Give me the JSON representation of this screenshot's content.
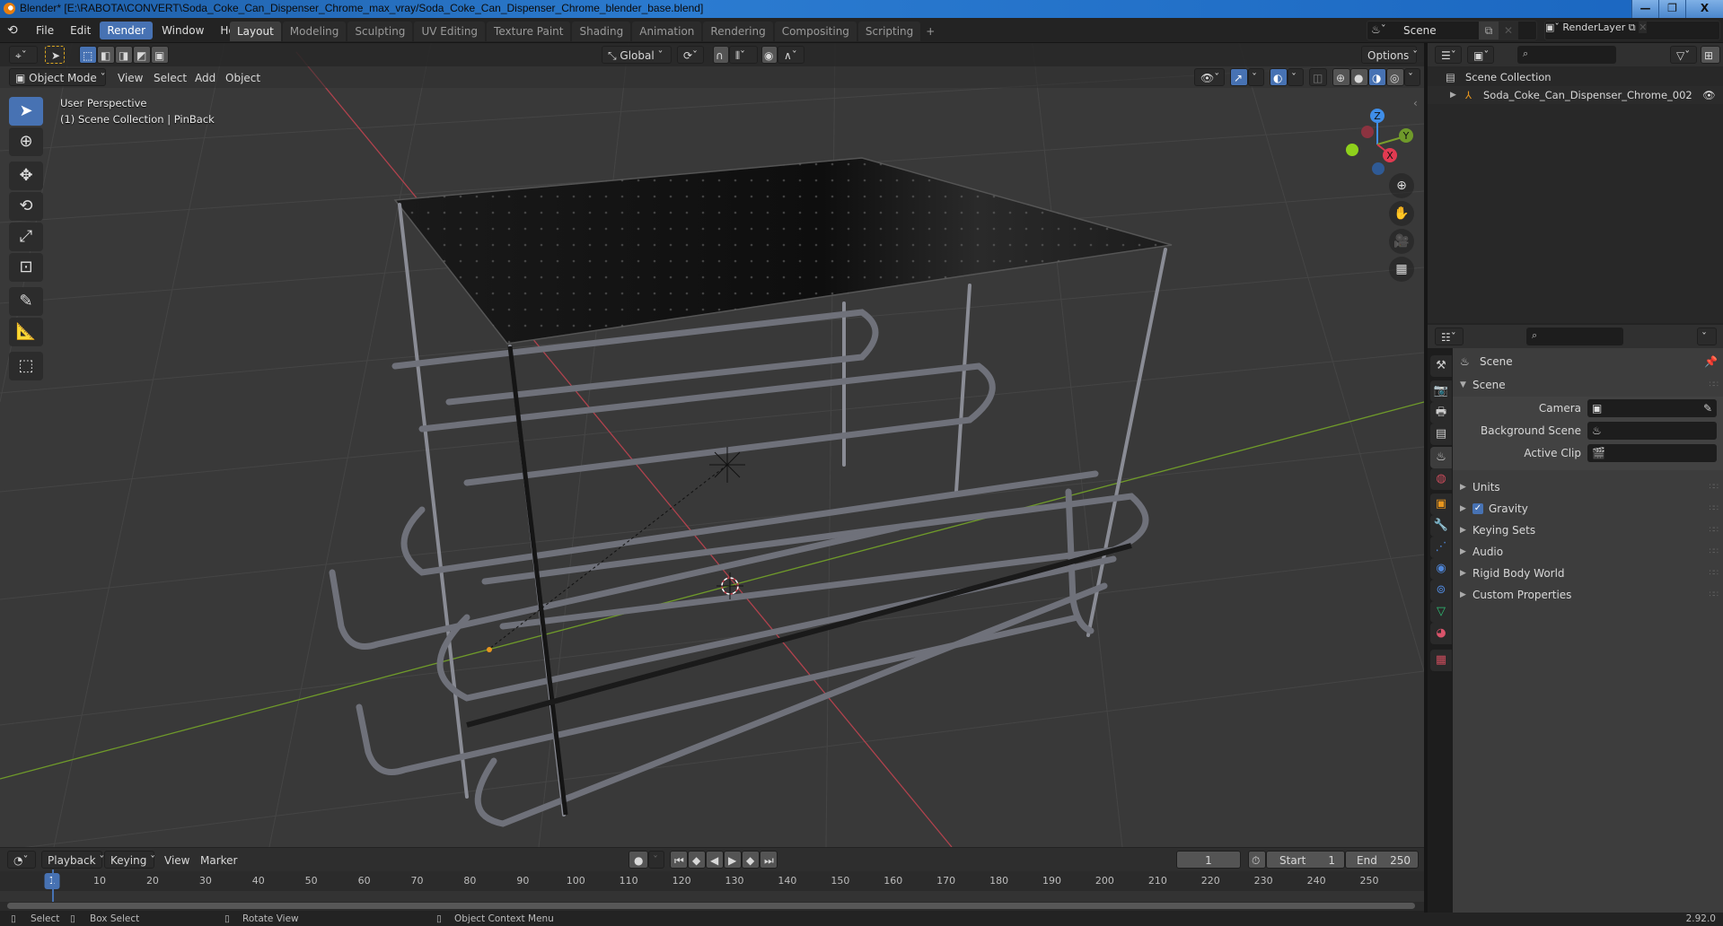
{
  "window": {
    "title": "Blender* [E:\\RABOTA\\CONVERT\\Soda_Coke_Can_Dispenser_Chrome_max_vray/Soda_Coke_Can_Dispenser_Chrome_blender_base.blend]",
    "controls": {
      "minimize": "—",
      "restore": "❐",
      "close": "X"
    }
  },
  "menu": [
    "File",
    "Edit",
    "Render",
    "Window",
    "Help"
  ],
  "menu_active": "Render",
  "workspaces": [
    "Layout",
    "Modeling",
    "Sculpting",
    "UV Editing",
    "Texture Paint",
    "Shading",
    "Animation",
    "Rendering",
    "Compositing",
    "Scripting"
  ],
  "workspace_active": "Layout",
  "workspace_add": "+",
  "scene_selector": {
    "value": "Scene"
  },
  "view_layer_selector": {
    "value": "RenderLayer"
  },
  "viewport": {
    "mode": "Object Mode",
    "header_menus": [
      "View",
      "Select",
      "Add",
      "Object"
    ],
    "transform_orientation": "Global",
    "options_label": "Options",
    "overlay_line1": "User Perspective",
    "overlay_line2": "(1) Scene Collection | PinBack",
    "gizmo_axes": {
      "x": "X",
      "y": "Y",
      "z": "Z"
    },
    "colors": {
      "x_axis": "#c8434f",
      "y_axis": "#7a9e2c",
      "background": "#393939"
    }
  },
  "outliner": {
    "search_placeholder": "",
    "root": "Scene Collection",
    "items": [
      {
        "label": "Soda_Coke_Can_Dispenser_Chrome_002",
        "visible": true
      }
    ]
  },
  "properties": {
    "context": "Scene",
    "panel_title": "Scene",
    "fields": [
      {
        "label": "Camera",
        "value": ""
      },
      {
        "label": "Background Scene",
        "value": ""
      },
      {
        "label": "Active Clip",
        "value": ""
      }
    ],
    "sections": [
      "Units",
      "Gravity",
      "Keying Sets",
      "Audio",
      "Rigid Body World",
      "Custom Properties"
    ],
    "gravity_checked": true
  },
  "timeline": {
    "menus": [
      "Playback",
      "Keying",
      "View",
      "Marker"
    ],
    "current_frame": "1",
    "start_label": "Start",
    "start": "1",
    "end_label": "End",
    "end": "250",
    "ticks": [
      "10",
      "20",
      "30",
      "40",
      "50",
      "60",
      "70",
      "80",
      "90",
      "100",
      "110",
      "120",
      "130",
      "140",
      "150",
      "160",
      "170",
      "180",
      "190",
      "200",
      "210",
      "220",
      "230",
      "240",
      "250"
    ]
  },
  "statusbar": {
    "items": [
      "Select",
      "Box Select",
      "Rotate View",
      "Object Context Menu"
    ],
    "version": "2.92.0"
  }
}
